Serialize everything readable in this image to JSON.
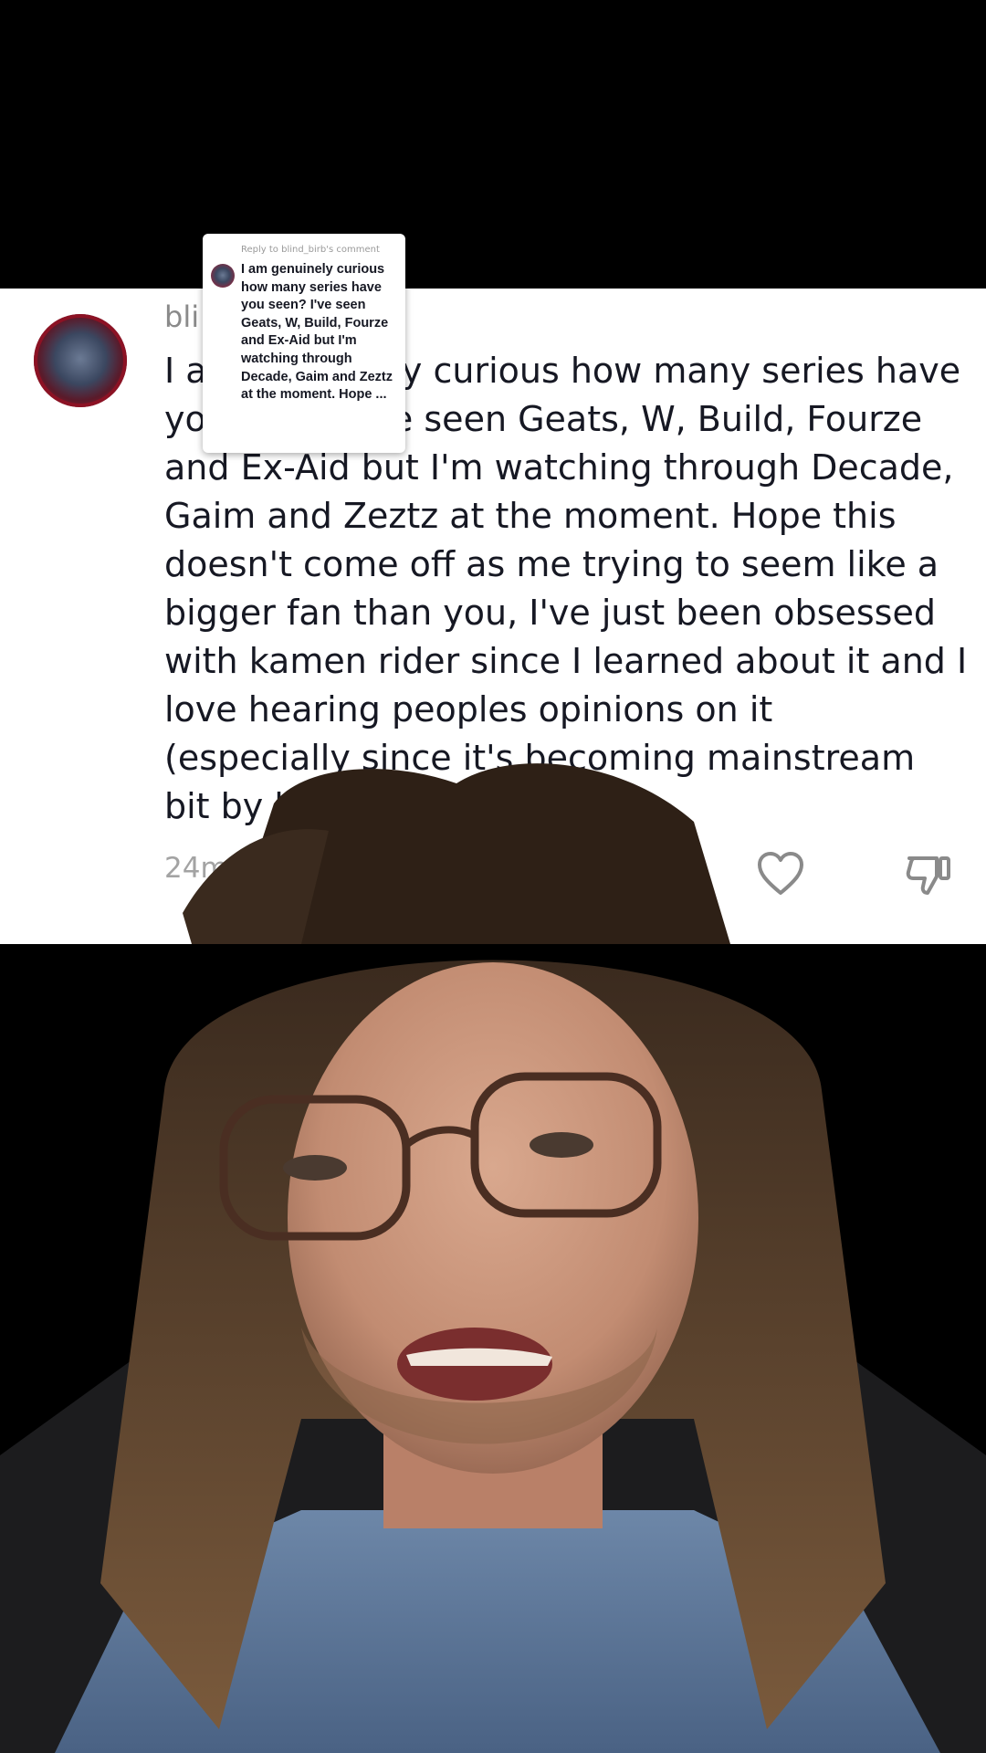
{
  "comment": {
    "username": "bli",
    "body": "I am genuinely curious how many series have you seen? I've seen Geats, W, Build, Fourze and Ex-Aid but I'm watching through Decade, Gaim and Zeztz at the moment. Hope this doesn't come off as me trying to seem like a bigger fan than you, I've just been obsessed with kamen rider since I learned about it and I love hearing peoples opinions on it (especially since it's becoming mainstream bit by bit)",
    "time": "24m",
    "reply_label": "R"
  },
  "reply_bubble": {
    "header": "Reply to blind_birb's comment",
    "text": "I am genuinely curious how many series have you seen? I've seen Geats, W, Build, Fourze and Ex-Aid but I'm watching through Decade, Gaim and Zeztz at the moment. Hope ..."
  },
  "icons": {
    "like": "heart-icon",
    "dislike": "thumbs-down-icon"
  },
  "colors": {
    "background": "#000000",
    "card": "#ffffff",
    "text": "#161823",
    "muted": "#8a8a8a"
  }
}
